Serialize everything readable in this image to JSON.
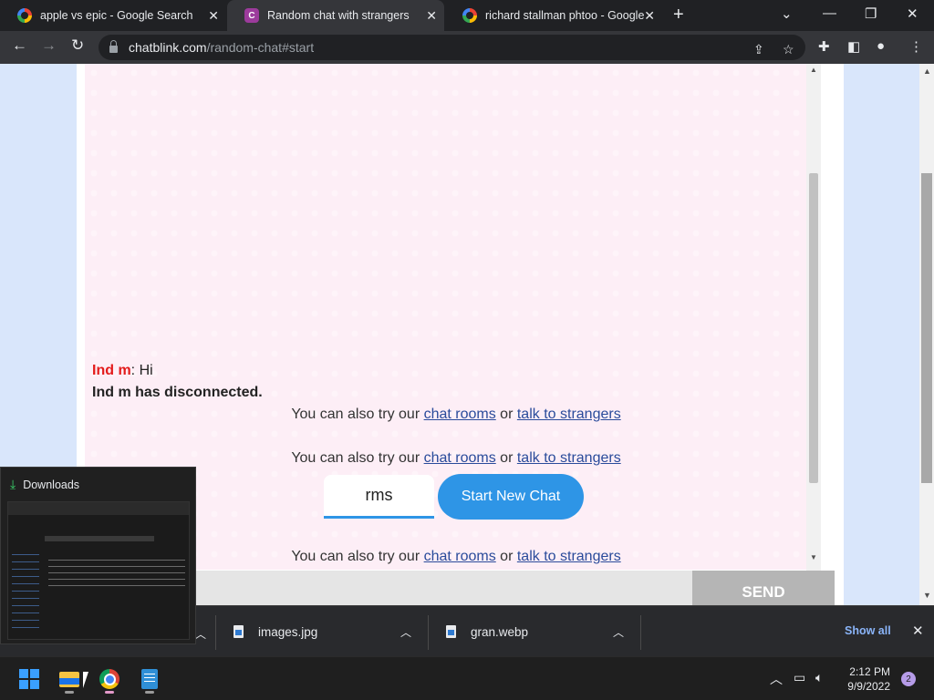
{
  "browser": {
    "tabs": [
      {
        "title": "apple vs epic - Google Search",
        "favicon": "google-icon"
      },
      {
        "title": "Random chat with strangers",
        "favicon": "chatblink-icon"
      },
      {
        "title": "richard stallman phtoo - Google",
        "favicon": "google-icon"
      }
    ],
    "url_host": "chatblink.com",
    "url_path": "/random-chat#start"
  },
  "chat": {
    "messages": [
      {
        "sender": "Ind m",
        "text": ": Hi"
      },
      {
        "system": "Ind m has disconnected."
      }
    ],
    "hint_prefix": "You can also try our ",
    "hint_link1": "chat rooms",
    "hint_mid": " or ",
    "hint_link2": "talk to strangers",
    "name_value": "rms",
    "start_button": "Start New Chat",
    "send_button": "SEND"
  },
  "downloads": {
    "popup_title": "Downloads",
    "items": [
      {
        "name": "images.jpg"
      },
      {
        "name": "gran.webp"
      }
    ],
    "show_all": "Show all"
  },
  "taskbar": {
    "time": "2:12 PM",
    "date": "9/9/2022",
    "notification_count": "2"
  },
  "colors": {
    "accent": "#2e95e6",
    "sender": "#e31b1b",
    "chat_bg": "#fdeef6"
  }
}
